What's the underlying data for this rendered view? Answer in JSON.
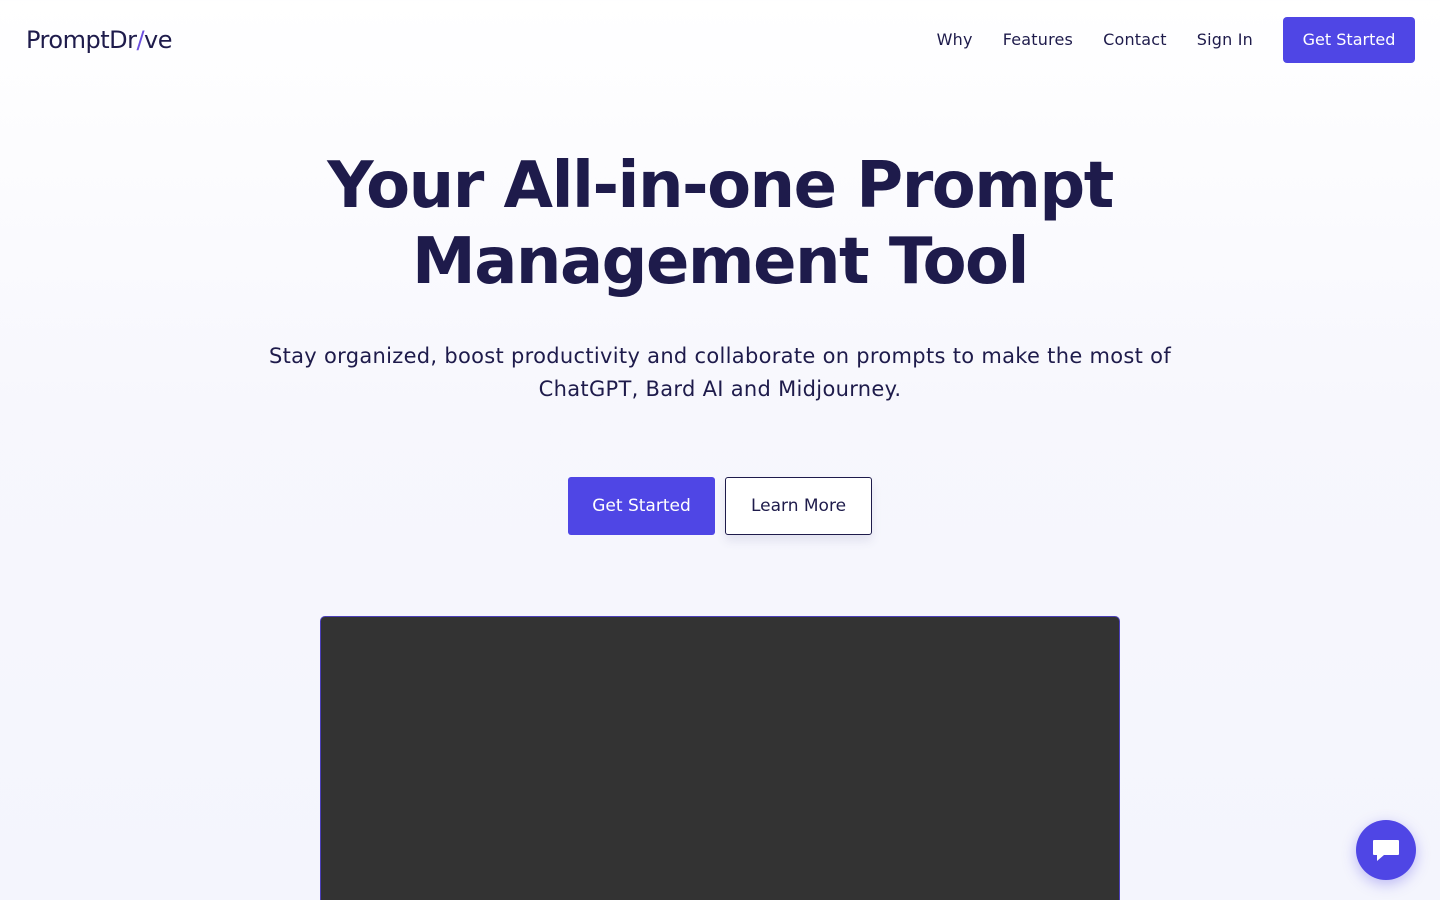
{
  "header": {
    "logo": {
      "part1": "PromptDr",
      "slash": "/",
      "part2": "ve"
    },
    "nav": [
      {
        "label": "Why"
      },
      {
        "label": "Features"
      },
      {
        "label": "Contact"
      },
      {
        "label": "Sign In"
      }
    ],
    "cta_label": "Get Started"
  },
  "hero": {
    "title_line1": "Your All-in-one Prompt",
    "title_line2": "Management Tool",
    "subtitle": "Stay organized, boost productivity and collaborate on prompts to make the most of ChatGPT, Bard AI and Midjourney.",
    "primary_button": "Get Started",
    "secondary_button": "Learn More"
  },
  "chat_widget": {
    "icon": "chat-bubble-icon"
  },
  "colors": {
    "brand": "#4f46e5",
    "text": "#1e1b4b",
    "panel": "#333333"
  }
}
